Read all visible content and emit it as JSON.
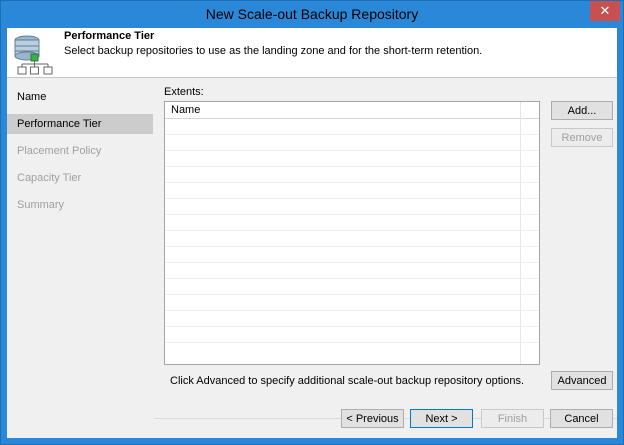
{
  "window": {
    "title": "New Scale-out Backup Repository",
    "close_label": "✕"
  },
  "header": {
    "title": "Performance Tier",
    "subtitle": "Select backup repositories to use as the landing zone and for the short-term retention.",
    "icon": "repository-icon"
  },
  "nav": {
    "items": [
      {
        "label": "Name",
        "state": "done"
      },
      {
        "label": "Performance Tier",
        "state": "active"
      },
      {
        "label": "Placement Policy",
        "state": "pending"
      },
      {
        "label": "Capacity Tier",
        "state": "pending"
      },
      {
        "label": "Summary",
        "state": "pending"
      }
    ]
  },
  "extents": {
    "label": "Extents:",
    "columns": [
      "Name"
    ],
    "rows": [],
    "add_label": "Add...",
    "remove_label": "Remove"
  },
  "advanced": {
    "hint": "Click Advanced to specify additional scale-out backup repository options.",
    "button_label": "Advanced"
  },
  "footer": {
    "previous_label": "< Previous",
    "next_label": "Next >",
    "finish_label": "Finish",
    "cancel_label": "Cancel"
  },
  "colors": {
    "titlebar": "#2b88d8",
    "close": "#c75050",
    "selection": "#cccccc",
    "panel": "#f0f0f0"
  }
}
